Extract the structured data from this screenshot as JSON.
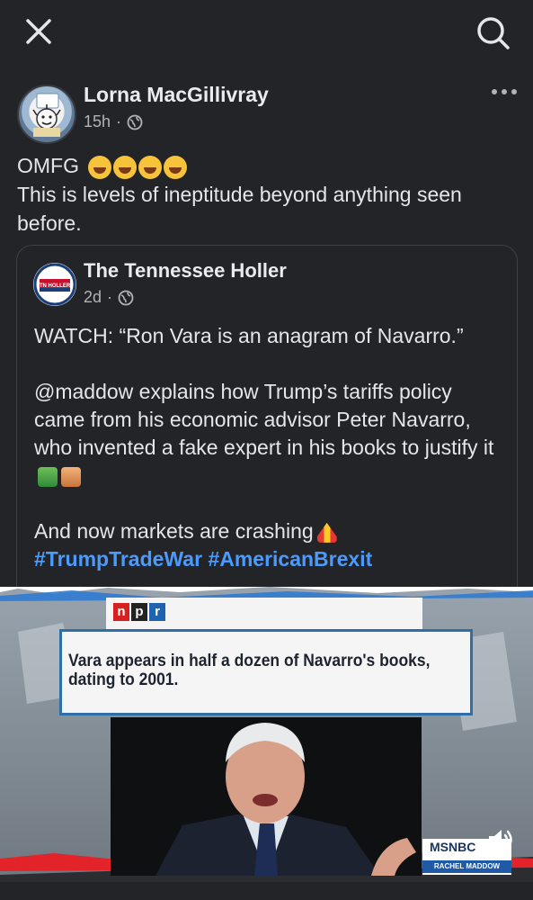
{
  "topbar": {
    "close_icon": "close-icon",
    "search_icon": "search-icon"
  },
  "post": {
    "author": "Lorna MacGillivray",
    "time": "15h",
    "separator": "·",
    "privacy_icon": "globe-icon",
    "text_line1": "OMFG",
    "emojis": [
      "rolling-laughing",
      "rolling-laughing",
      "rolling-laughing",
      "rolling-laughing"
    ],
    "text_line2": "This is levels of ineptitude beyond anything seen before."
  },
  "shared": {
    "author": "The Tennessee Holler",
    "time": "2d",
    "separator": "·",
    "privacy_icon": "globe-icon",
    "p1": "WATCH: “Ron Vara is an anagram of Navarro.”",
    "p2": "@maddow explains how Trump’s tariffs policy came from his economic advisor Peter Navarro, who invented a fake expert in his books to justify it",
    "p3": "And now markets are crashing",
    "hashtag1": "#TrumpTradeWar",
    "hashtag2": "#AmericanBrexit"
  },
  "video": {
    "npr_letters": [
      "n",
      "p",
      "r"
    ],
    "caption": "Vara appears in half a dozen of Navarro's books, dating to 2001.",
    "network": "MSNBC",
    "show": "RACHEL MADDOW"
  },
  "colors": {
    "background": "#232427",
    "link": "#4b9bff",
    "npr_red": "#d62021",
    "npr_black": "#222222",
    "npr_blue": "#1f62b0"
  }
}
